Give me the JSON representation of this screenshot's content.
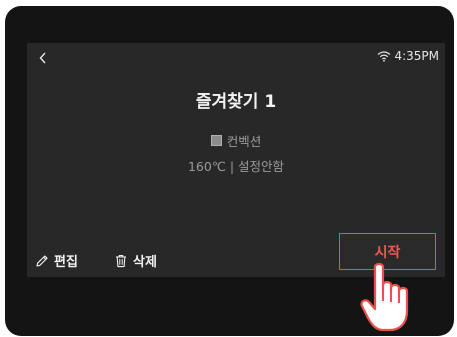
{
  "header": {
    "time": "4:35PM"
  },
  "program": {
    "title": "즐겨찾기 1",
    "mode": "컨벡션",
    "settings": "160℃ | 설정안함"
  },
  "actions": {
    "edit_label": "편집",
    "delete_label": "삭제",
    "start_label": "시작"
  },
  "icons": {
    "back": "chevron-left-icon",
    "wifi": "wifi-icon",
    "mode": "convection-mode-icon",
    "edit": "pencil-icon",
    "delete": "trash-icon",
    "pointer": "pointing-hand-icon"
  },
  "colors": {
    "screen_background": "#282828",
    "device_bezel": "#141414",
    "accent": "#e8524a",
    "primary_text": "#f2f2f2",
    "secondary_text": "#9a9a9a"
  }
}
